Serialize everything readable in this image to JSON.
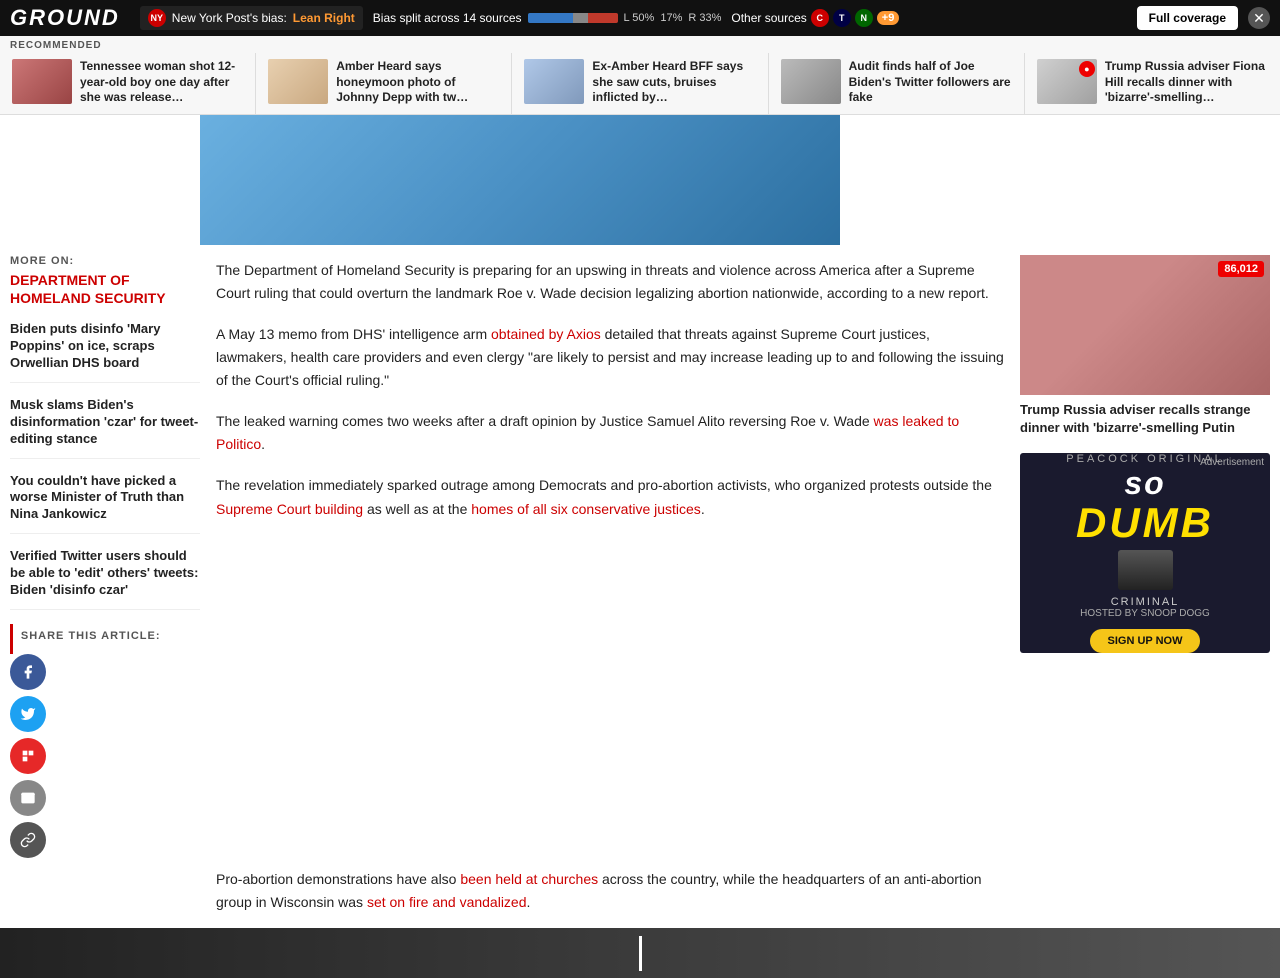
{
  "topnav": {
    "logo": "GROUND",
    "source_bias": {
      "icon_text": "NY",
      "source_name": "New York Post's bias:",
      "bias_label": "Lean Right"
    },
    "bias_split": {
      "label": "Bias split across 14 sources",
      "left_pct": "L 50%",
      "left_val": 50,
      "center_val": 17,
      "center_pct": "17%",
      "right_pct": "R 33%",
      "right_val": 33
    },
    "other_sources": "Other sources",
    "other_count": "+9",
    "full_coverage": "Full coverage"
  },
  "recommended": {
    "label": "RECOMMENDED",
    "items": [
      {
        "text": "Tennessee woman shot 12-year-old boy one day after she was release…"
      },
      {
        "text": "Amber Heard says honeymoon photo of Johnny Depp with tw…"
      },
      {
        "text": "Ex-Amber Heard BFF says she saw cuts, bruises inflicted by…"
      },
      {
        "text": "Audit finds half of Joe Biden's Twitter followers are fake"
      },
      {
        "text": "Trump Russia adviser Fiona Hill recalls dinner with 'bizarre'-smelling…"
      }
    ]
  },
  "sidebar": {
    "more_on_label": "MORE ON:",
    "more_on_topic": "DEPARTMENT OF HOMELAND SECURITY",
    "links": [
      "Biden puts disinfo 'Mary Poppins' on ice, scraps Orwellian DHS board",
      "Musk slams Biden's disinformation 'czar' for tweet-editing stance",
      "You couldn't have picked a worse Minister of Truth than Nina Jankowicz",
      "Verified Twitter users should be able to 'edit' others' tweets: Biden 'disinfo czar'"
    ],
    "share_label": "SHARE THIS ARTICLE:",
    "share_buttons": [
      {
        "name": "facebook",
        "symbol": "f",
        "color_class": "share-fb"
      },
      {
        "name": "twitter",
        "symbol": "t",
        "color_class": "share-tw"
      },
      {
        "name": "flipboard",
        "symbol": "f",
        "color_class": "share-fl"
      },
      {
        "name": "email",
        "symbol": "@",
        "color_class": "share-em"
      },
      {
        "name": "copy",
        "symbol": "⛓",
        "color_class": "share-cp"
      }
    ]
  },
  "article": {
    "paragraphs": [
      "The Department of Homeland Security is preparing for an upswing in threats and violence across America after a Supreme Court ruling that could overturn the landmark Roe v. Wade decision legalizing abortion nationwide, according to a new report.",
      "A May 13 memo from DHS' intelligence arm obtained by Axios detailed that threats against Supreme Court justices, lawmakers, health care providers and even clergy \"are likely to persist and may increase leading up to and following the issuing of the Court's official ruling.\"",
      "The leaked warning comes two weeks after a draft opinion by Justice Samuel Alito reversing Roe v. Wade was leaked to Politico.",
      "The revelation immediately sparked outrage among Democrats and pro-abortion activists, who organized protests outside the Supreme Court building as well as at the homes of all six conservative justices."
    ],
    "link1_text": "obtained by Axios",
    "link2_text": "was leaked to Politico",
    "link3_text": "Supreme Court building",
    "link4_text": "homes of all six conservative justices"
  },
  "bottom_article": {
    "text1": "Pro-abortion demonstrations have also been held at churches across the country, while the headquarters of an anti-abortion group in Wisconsin was set on fire and vandalized.",
    "link1": "been held at churches",
    "link2": "set on fire and vandalized"
  },
  "right_sidebar": {
    "article_card": {
      "badge": "86,012",
      "title": "Trump Russia adviser recalls strange dinner with 'bizarre'-smelling Putin"
    },
    "ad": {
      "label": "Advertisement",
      "brand": "peacock original",
      "title": "DUMB",
      "title_prefix": "so",
      "subtitle": "CRIMINAL",
      "hosted_by": "HOSTED BY SNOOP DOGG",
      "cta": "SIGN UP NOW"
    }
  }
}
